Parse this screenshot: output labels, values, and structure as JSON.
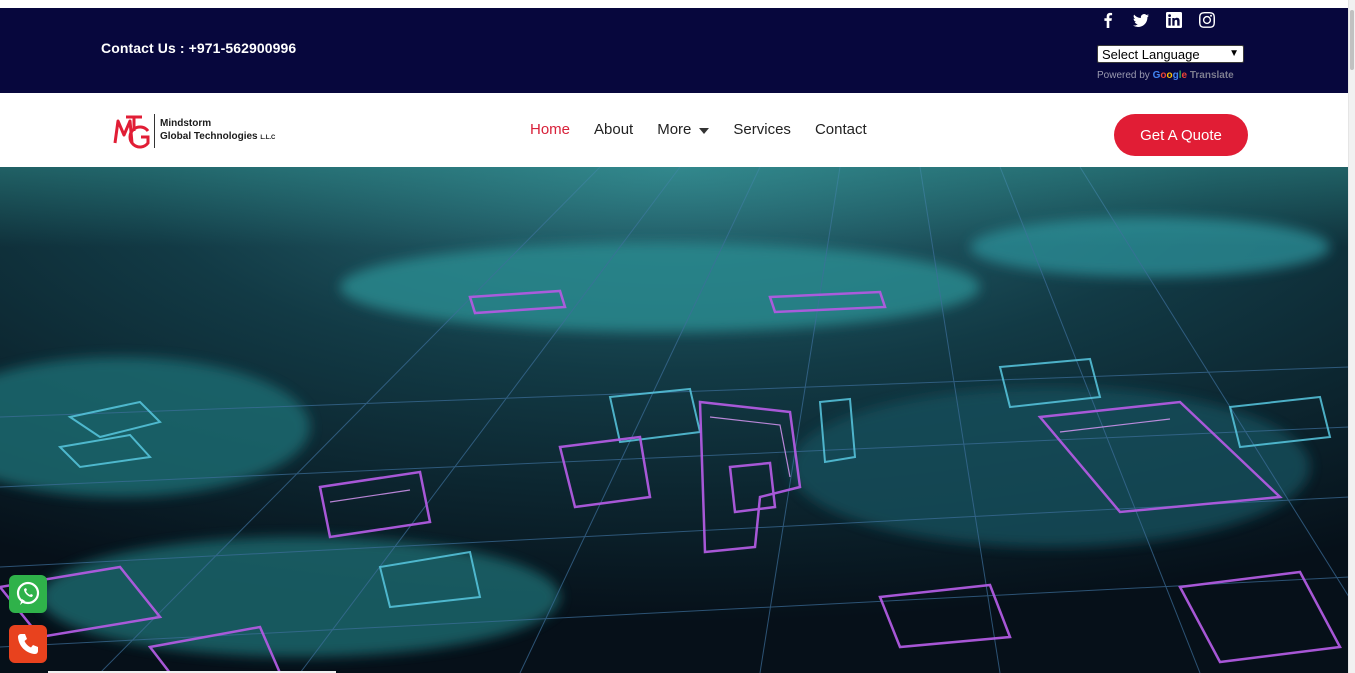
{
  "topbar": {
    "contact": "Contact Us : +971-562900996",
    "social": [
      {
        "name": "facebook-icon"
      },
      {
        "name": "twitter-icon"
      },
      {
        "name": "linkedin-icon"
      },
      {
        "name": "instagram-icon"
      }
    ],
    "language_select": "Select Language",
    "powered_by": "Powered by",
    "google": "Google",
    "translate": "Translate"
  },
  "header": {
    "logo": {
      "line1": "Mindstorm",
      "line2": "Global Technologies",
      "llc": "L.L.C"
    },
    "nav": [
      {
        "label": "Home",
        "active": true
      },
      {
        "label": "About"
      },
      {
        "label": "More",
        "dropdown": true
      },
      {
        "label": "Services"
      },
      {
        "label": "Contact"
      }
    ],
    "cta": "Get A Quote"
  },
  "floating": {
    "whatsapp": "whatsapp-icon",
    "phone": "phone-icon"
  },
  "colors": {
    "topbar": "#07073d",
    "accent": "#e11d35",
    "nav_active": "#d8213a"
  }
}
